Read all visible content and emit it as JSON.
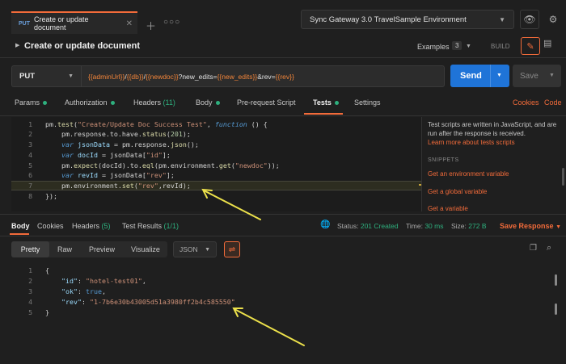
{
  "tab": {
    "method": "PUT",
    "title": "Create or update document"
  },
  "environment": {
    "name": "Sync Gateway 3.0 TravelSample Environment"
  },
  "request": {
    "name": "Create or update document",
    "examples_label": "Examples",
    "examples_count": "3",
    "build_label": "BUILD",
    "method": "PUT",
    "url_parts": [
      {
        "text": "{{adminUrl}}",
        "var": true
      },
      {
        "text": "/",
        "var": false
      },
      {
        "text": "{{db}}",
        "var": true
      },
      {
        "text": "/",
        "var": false
      },
      {
        "text": "{{newdoc}}",
        "var": true
      },
      {
        "text": "?new_edits=",
        "var": false
      },
      {
        "text": "{{new_edits}}",
        "var": true
      },
      {
        "text": "&rev=",
        "var": false
      },
      {
        "text": "{{rev}}",
        "var": true
      }
    ],
    "send_label": "Send",
    "save_label": "Save"
  },
  "request_tabs": {
    "params": "Params",
    "authorization": "Authorization",
    "headers": "Headers",
    "headers_count": "(11)",
    "body": "Body",
    "prerequest": "Pre-request Script",
    "tests": "Tests",
    "settings": "Settings",
    "cookies": "Cookies",
    "code": "Code"
  },
  "editor": {
    "line_numbers": [
      "1",
      "2",
      "3",
      "4",
      "5",
      "6",
      "7",
      "8"
    ]
  },
  "snippets": {
    "description": "Test scripts are written in JavaScript, and are run after the response is received.",
    "learn_more": "Learn more about tests scripts",
    "heading": "SNIPPETS",
    "items": [
      "Get an environment variable",
      "Get a global variable",
      "Get a variable"
    ]
  },
  "response": {
    "tabs": {
      "body": "Body",
      "cookies": "Cookies",
      "headers": "Headers",
      "headers_count": "(5)",
      "test_results": "Test Results",
      "test_count": "(1/1)"
    },
    "status_label": "Status:",
    "status_value": "201 Created",
    "time_label": "Time:",
    "time_value": "30 ms",
    "size_label": "Size:",
    "size_value": "272 B",
    "save_response": "Save Response",
    "views": {
      "pretty": "Pretty",
      "raw": "Raw",
      "preview": "Preview",
      "visualize": "Visualize"
    },
    "format": "JSON",
    "line_numbers": [
      "1",
      "2",
      "3",
      "4",
      "5"
    ],
    "json": {
      "open": "{",
      "id_key": "\"id\"",
      "id_val": "\"hotel-test01\"",
      "ok_key": "\"ok\"",
      "ok_val": "true",
      "rev_key": "\"rev\"",
      "rev_val": "\"1-7b6e30b43005d51a3980ff2b4c585550\"",
      "close": "}"
    }
  },
  "icons": {
    "close": "close-icon",
    "plus": "plus-icon",
    "more": "more-icon",
    "eye": "eye-icon",
    "settings": "settings-icon",
    "pencil": "pencil-icon",
    "document": "document-icon",
    "globe": "globe-icon",
    "wrap": "wrap-icon",
    "copy": "copy-icon",
    "search": "search-icon"
  },
  "colors": {
    "accent": "#f26b3a",
    "send": "#1f74d8",
    "success": "#2eb07e",
    "arrow": "#ece14b"
  }
}
